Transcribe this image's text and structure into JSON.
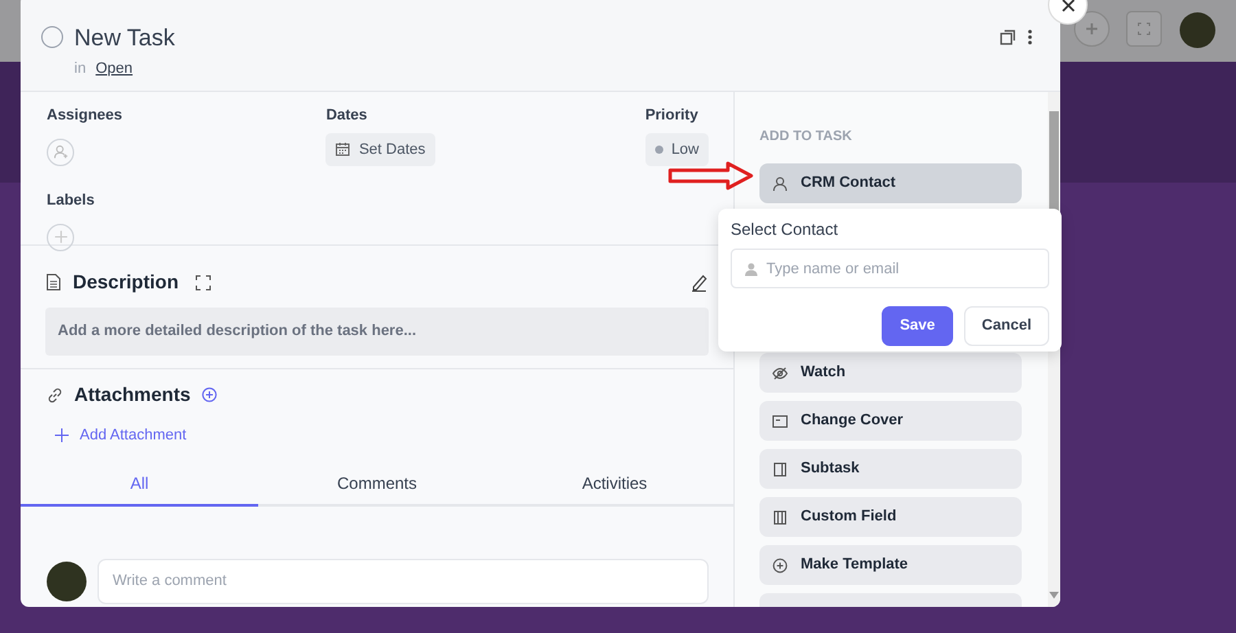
{
  "task": {
    "title": "New Task",
    "list_prefix": "in",
    "list_name": "Open",
    "completed": false
  },
  "fields": {
    "assignees_label": "Assignees",
    "dates_label": "Dates",
    "dates_button": "Set Dates",
    "priority_label": "Priority",
    "priority_value": "Low",
    "labels_label": "Labels"
  },
  "description": {
    "title": "Description",
    "prompt": "Add a more detailed description of the task here..."
  },
  "attachments": {
    "title": "Attachments",
    "add_link": "Add Attachment"
  },
  "tabs": [
    {
      "label": "All",
      "selected": true
    },
    {
      "label": "Comments",
      "selected": false
    },
    {
      "label": "Activities",
      "selected": false
    }
  ],
  "comment": {
    "placeholder": "Write a comment"
  },
  "add_to_task": {
    "heading": "ADD TO TASK",
    "actions": [
      {
        "label": "CRM Contact",
        "selected": true
      },
      {
        "label": "Watch",
        "selected": false
      },
      {
        "label": "Change Cover",
        "selected": false
      },
      {
        "label": "Subtask",
        "selected": false
      },
      {
        "label": "Custom Field",
        "selected": false
      },
      {
        "label": "Make Template",
        "selected": false
      }
    ]
  },
  "popover": {
    "title": "Select Contact",
    "search": {
      "placeholder": "Type name or email"
    },
    "buttons": [
      {
        "label": "Save",
        "kind": "primary"
      },
      {
        "label": "Cancel",
        "kind": "secondary"
      }
    ]
  }
}
